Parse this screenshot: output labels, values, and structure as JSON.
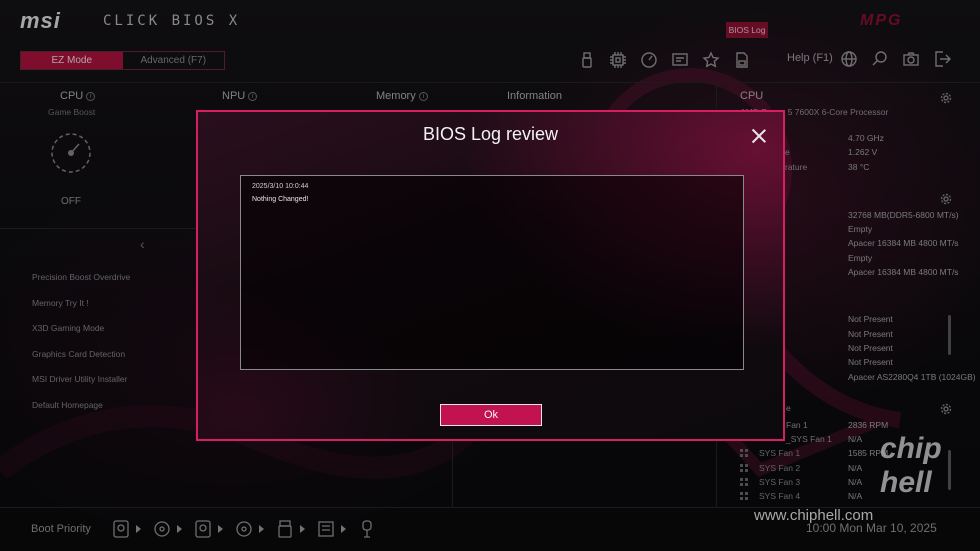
{
  "header": {
    "brand": "msi",
    "product": "CLICK BIOS X",
    "board_logo": "MPG",
    "bios_log_label": "BIOS Log",
    "modes": [
      "EZ Mode",
      "Advanced (F7)"
    ],
    "active_mode": "EZ Mode",
    "help_label": "Help (F1)",
    "toolbar_icons": [
      "usb-icon",
      "chip-icon",
      "speedometer-icon",
      "monitor-info-icon",
      "star-icon",
      "save-icon"
    ],
    "right_icons": [
      "globe-icon",
      "search-icon",
      "camera-icon",
      "exit-icon"
    ]
  },
  "info_tabs": {
    "cpu": {
      "label": "CPU",
      "sub": "Game Boost",
      "state": "OFF"
    },
    "npu": {
      "label": "NPU"
    },
    "memory": {
      "label": "Memory"
    },
    "information": {
      "label": "Information"
    }
  },
  "menu": {
    "items": [
      "Precision Boost Overdrive",
      "Memory Try It !",
      "X3D Gaming Mode",
      "Graphics Card Detection",
      "MSI Driver Utility Installer",
      "Default Homepage"
    ]
  },
  "right_panel": {
    "cpu_title": "CPU",
    "cpu_name": "AMD Ryzen 5 7600X 6-Core Processor",
    "cpu_stats": [
      {
        "label": "",
        "value": "4.70 GHz"
      },
      {
        "label": "e",
        "value": "1.262 V"
      },
      {
        "label": "rature",
        "value": "38 °C"
      }
    ],
    "memory_stats": [
      {
        "label": "",
        "value": "32768 MB(DDR5-6800 MT/s)"
      },
      {
        "label": "",
        "value": "Empty"
      },
      {
        "label": "",
        "value": "Apacer 16384 MB 4800 MT/s"
      },
      {
        "label": "",
        "value": "Empty"
      },
      {
        "label": "",
        "value": "Apacer 16384 MB 4800 MT/s"
      }
    ],
    "storage_stats": [
      {
        "label": "",
        "value": "Not Present"
      },
      {
        "label": "",
        "value": "Not Present"
      },
      {
        "label": "",
        "value": "Not Present"
      },
      {
        "label": "",
        "value": "Not Present"
      },
      {
        "label": "",
        "value": "Apacer AS2280Q4 1TB (1024GB)"
      }
    ],
    "fan_title": "e",
    "fans": [
      {
        "label": "Fan 1",
        "value": "2836 RPM"
      },
      {
        "label": "_SYS Fan 1",
        "value": "N/A"
      },
      {
        "label": "SYS Fan 1",
        "value": "1585 RPM"
      },
      {
        "label": "SYS Fan 2",
        "value": "N/A"
      },
      {
        "label": "SYS Fan 3",
        "value": "N/A"
      },
      {
        "label": "SYS Fan 4",
        "value": "N/A"
      }
    ]
  },
  "boot": {
    "label": "Boot Priority",
    "devices": [
      "hdd-icon",
      "optical-drive-icon",
      "hdd-icon",
      "optical-drive-icon",
      "usb-drive-icon",
      "usb-storage-icon",
      "usb-key-icon"
    ]
  },
  "status": {
    "clock": "10:00  Mon Mar 10, 2025"
  },
  "watermark": {
    "site": "www.chiphell.com",
    "logo": "chip hell"
  },
  "modal": {
    "title": "BIOS Log review",
    "log": {
      "timestamp": "2025/3/10 10:0:44",
      "message": "Nothing Changed!"
    },
    "ok_label": "Ok"
  },
  "colors": {
    "accent": "#c2124f",
    "modal_border": "#d81e63",
    "active_tab": "#b01241"
  }
}
